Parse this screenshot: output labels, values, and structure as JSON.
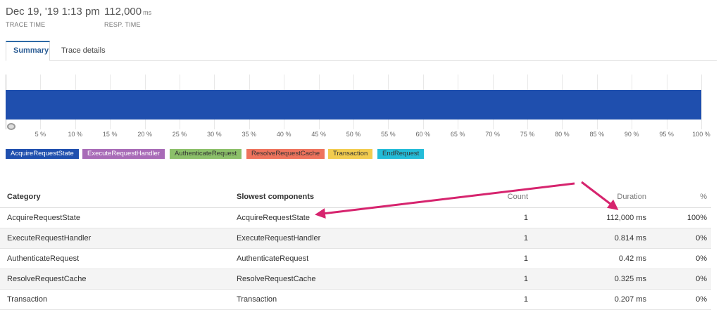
{
  "header": {
    "trace_time": {
      "value": "Dec 19, '19 1:13 pm",
      "label": "TRACE TIME"
    },
    "resp_time": {
      "value": "112,000",
      "unit": "ms",
      "label": "RESP. TIME"
    }
  },
  "tabs": [
    {
      "label": "Summary",
      "active": true
    },
    {
      "label": "Trace details",
      "active": false
    }
  ],
  "chart_data": {
    "type": "bar",
    "orientation": "horizontal",
    "xlim": [
      0,
      100
    ],
    "x_ticks": [
      "5 %",
      "10 %",
      "15 %",
      "20 %",
      "25 %",
      "30 %",
      "35 %",
      "40 %",
      "45 %",
      "50 %",
      "55 %",
      "60 %",
      "65 %",
      "70 %",
      "75 %",
      "80 %",
      "85 %",
      "90 %",
      "95 %",
      "100 %"
    ],
    "series": [
      {
        "name": "AcquireRequestState",
        "start": 0,
        "end": 100
      }
    ],
    "legend": [
      {
        "name": "AcquireRequestState",
        "color": "#1f4fae",
        "text_color": "#ffffff"
      },
      {
        "name": "ExecuteRequestHandler",
        "color": "#a86bb7",
        "text_color": "#ffffff"
      },
      {
        "name": "AuthenticateRequest",
        "color": "#8cc06a",
        "text_color": "#333333"
      },
      {
        "name": "ResolveRequestCache",
        "color": "#ee735d",
        "text_color": "#333333"
      },
      {
        "name": "Transaction",
        "color": "#f2cc4f",
        "text_color": "#333333"
      },
      {
        "name": "EndRequest",
        "color": "#24bcd8",
        "text_color": "#333333"
      }
    ],
    "grid": true
  },
  "table": {
    "headers": {
      "category": "Category",
      "components": "Slowest components",
      "count": "Count",
      "duration": "Duration",
      "percent": "%"
    },
    "rows": [
      {
        "category": "AcquireRequestState",
        "component": "AcquireRequestState",
        "count": "1",
        "duration": "112,000 ms",
        "percent": "100%"
      },
      {
        "category": "ExecuteRequestHandler",
        "component": "ExecuteRequestHandler",
        "count": "1",
        "duration": "0.814 ms",
        "percent": "0%"
      },
      {
        "category": "AuthenticateRequest",
        "component": "AuthenticateRequest",
        "count": "1",
        "duration": "0.42 ms",
        "percent": "0%"
      },
      {
        "category": "ResolveRequestCache",
        "component": "ResolveRequestCache",
        "count": "1",
        "duration": "0.325 ms",
        "percent": "0%"
      },
      {
        "category": "Transaction",
        "component": "Transaction",
        "count": "1",
        "duration": "0.207 ms",
        "percent": "0%"
      }
    ]
  },
  "annotation": {
    "arrow_color": "#d6246e"
  }
}
